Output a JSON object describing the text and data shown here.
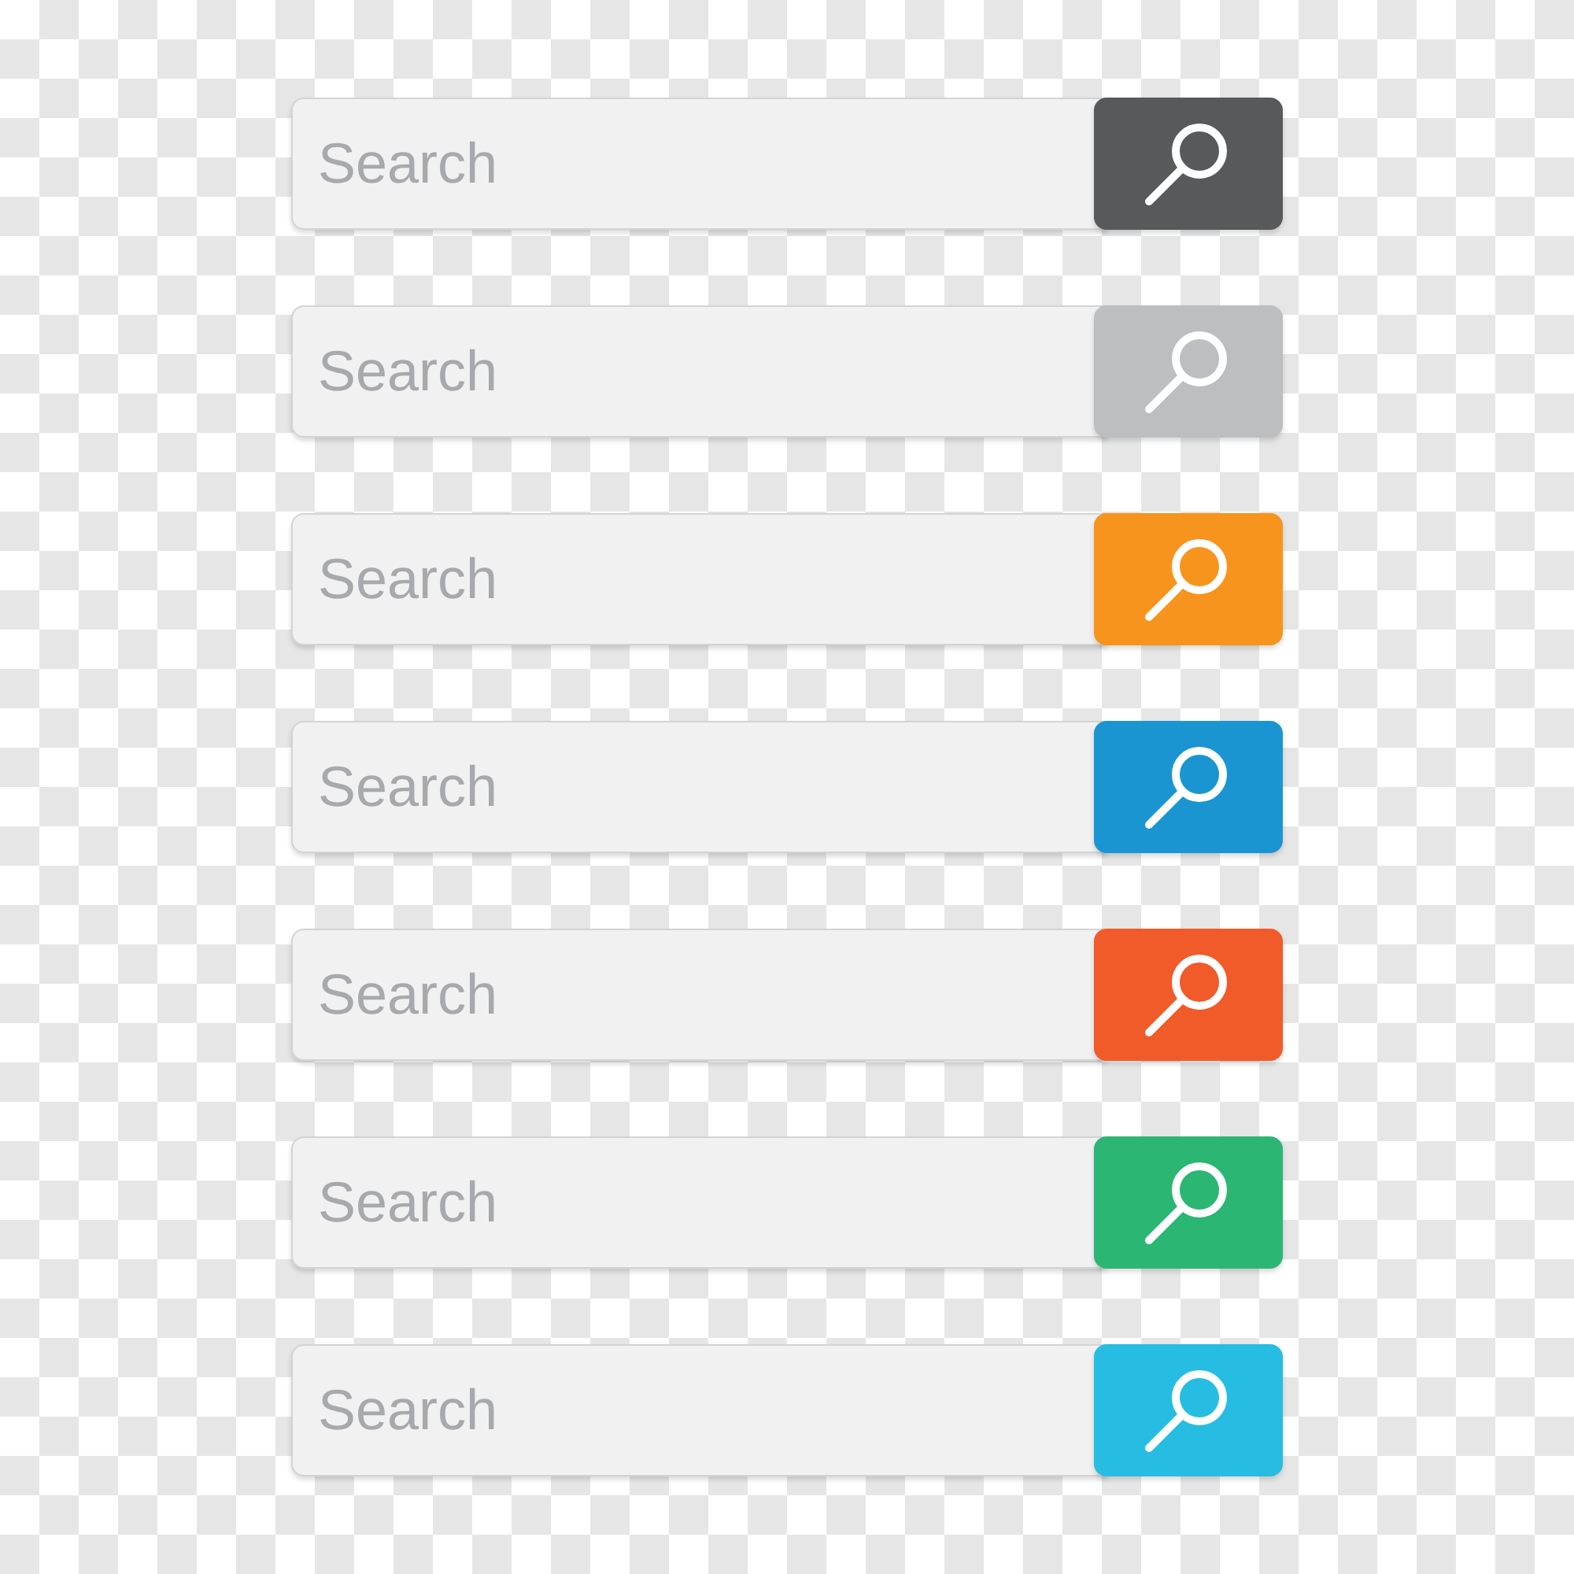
{
  "search_bars": [
    {
      "placeholder": "Search",
      "color": "#58595b"
    },
    {
      "placeholder": "Search",
      "color": "#bcbec0"
    },
    {
      "placeholder": "Search",
      "color": "#f7941d"
    },
    {
      "placeholder": "Search",
      "color": "#1b95d2"
    },
    {
      "placeholder": "Search",
      "color": "#f15a29"
    },
    {
      "placeholder": "Search",
      "color": "#2bb673"
    },
    {
      "placeholder": "Search",
      "color": "#27bde2"
    }
  ]
}
